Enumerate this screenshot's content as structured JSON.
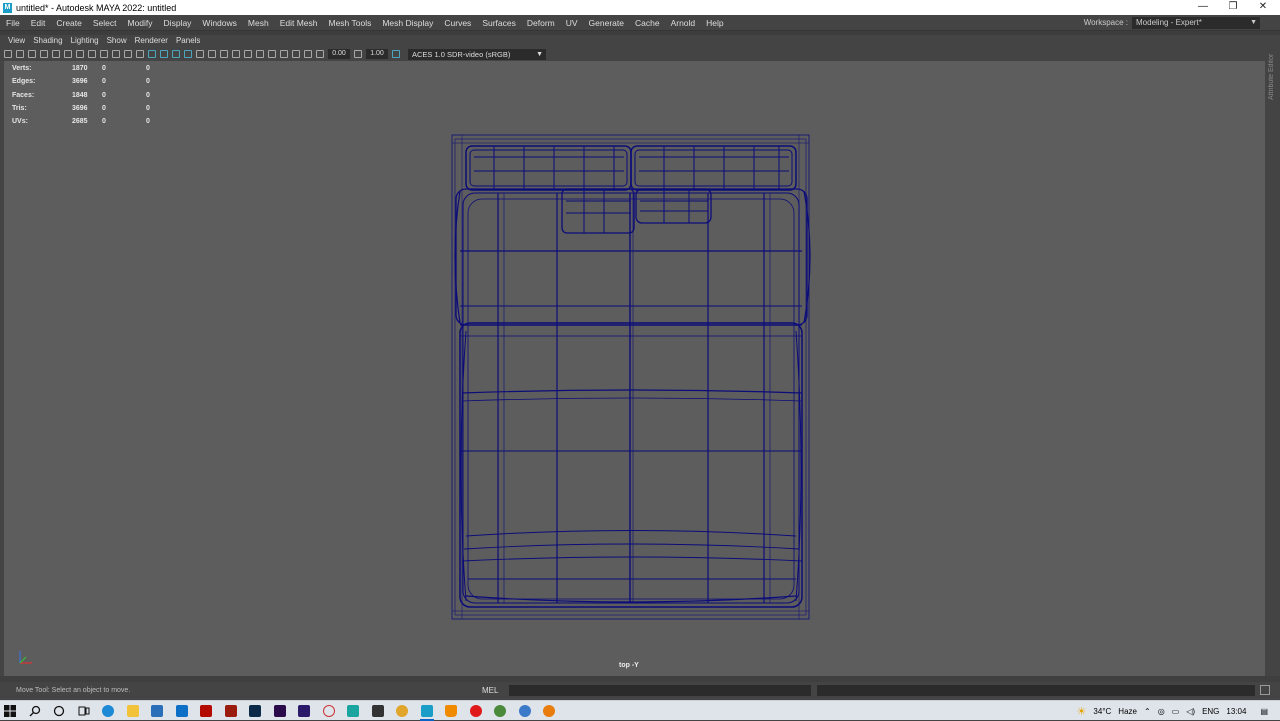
{
  "window": {
    "title": "untitled* - Autodesk MAYA 2022: untitled",
    "icon_letter": "M",
    "controls": [
      "—",
      "❐",
      "✕"
    ]
  },
  "menubar": {
    "items": [
      "File",
      "Edit",
      "Create",
      "Select",
      "Modify",
      "Display",
      "Windows",
      "Mesh",
      "Edit Mesh",
      "Mesh Tools",
      "Mesh Display",
      "Curves",
      "Surfaces",
      "Deform",
      "UV",
      "Generate",
      "Cache",
      "Arnold",
      "Help"
    ],
    "workspace_label": "Workspace :",
    "workspace_value": "Modeling - Expert*"
  },
  "panel_menu": {
    "items": [
      "View",
      "Shading",
      "Lighting",
      "Show",
      "Renderer",
      "Panels"
    ]
  },
  "viewport_toolbar": {
    "exposure": "0.00",
    "gamma": "1.00",
    "color_space": "ACES 1.0 SDR-video (sRGB)"
  },
  "hud": {
    "rows": [
      {
        "label": "Verts:",
        "v1": "1870",
        "v2": "0",
        "v3": "0"
      },
      {
        "label": "Edges:",
        "v1": "3696",
        "v2": "0",
        "v3": "0"
      },
      {
        "label": "Faces:",
        "v1": "1848",
        "v2": "0",
        "v3": "0"
      },
      {
        "label": "Tris:",
        "v1": "3696",
        "v2": "0",
        "v3": "0"
      },
      {
        "label": "UVs:",
        "v1": "2685",
        "v2": "0",
        "v3": "0"
      }
    ]
  },
  "camera_label": "top -Y",
  "side_panel_label": "Attribute Editor",
  "helpline": {
    "text": "Move Tool: Select an object to move.",
    "mel_label": "MEL"
  },
  "colors": {
    "viewport_bg": "#5d5d5d",
    "wireframe": "#0c0c7a",
    "ui_bg": "#444444",
    "accent": "#4fb7d6"
  },
  "taskbar": {
    "apps": [
      "start-icon",
      "search-icon",
      "cortana-icon",
      "task-view-icon",
      "edge-icon",
      "file-explorer-icon",
      "store-icon",
      "mail-icon",
      "acrobat-icon",
      "animate-icon",
      "photoshop-icon",
      "premiere-icon",
      "after-effects-icon",
      "recorder-icon",
      "3ds-icon",
      "calculator-icon",
      "chrome-icon",
      "maya-icon",
      "vlc-icon",
      "opera-icon",
      "chrome-alt-icon",
      "chrome-profile-icon",
      "blender-icon"
    ],
    "weather": "34°C",
    "weather_text": "Haze",
    "language": "ENG",
    "time": "13:04"
  }
}
